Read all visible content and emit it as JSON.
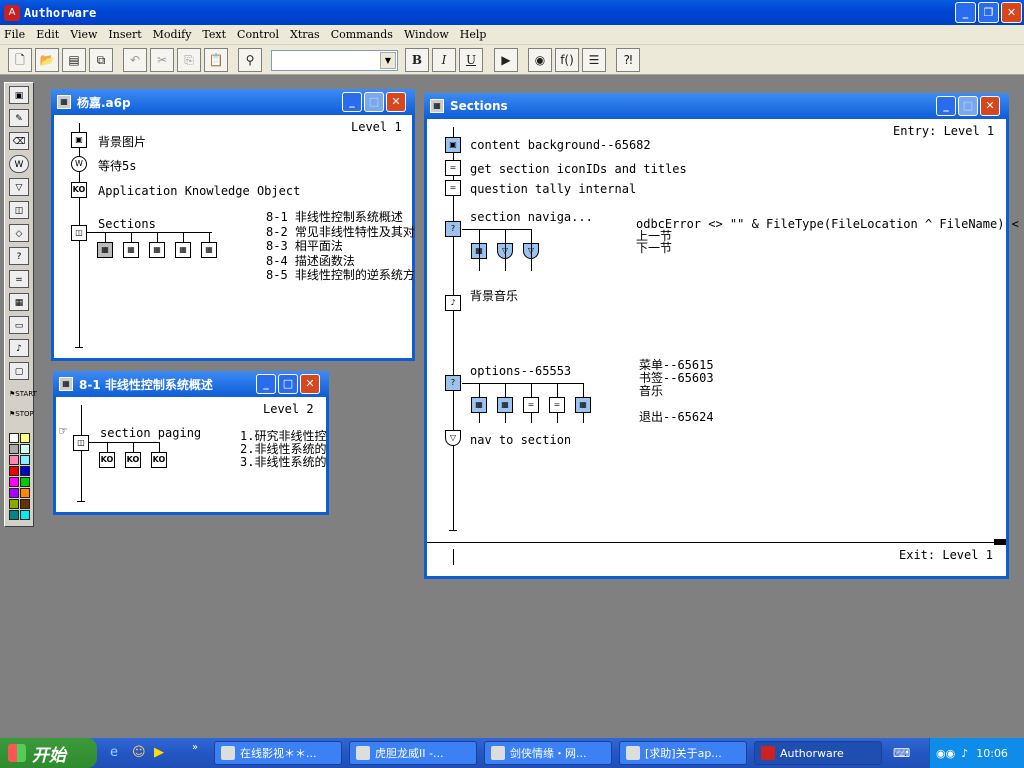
{
  "app": {
    "title": "Authorware"
  },
  "menu": [
    "File",
    "Edit",
    "View",
    "Insert",
    "Modify",
    "Text",
    "Control",
    "Xtras",
    "Commands",
    "Window",
    "Help"
  ],
  "toolbar": {
    "bold": "B",
    "italic": "I",
    "underline": "U",
    "combo_value": ""
  },
  "win_main": {
    "title": "杨嘉.a6p",
    "level": "Level 1",
    "items": [
      {
        "label": "背景图片",
        "icon": "display-icon"
      },
      {
        "label": "等待5s",
        "icon": "wait-icon"
      },
      {
        "label": "Application Knowledge Object",
        "icon": "ko-icon"
      },
      {
        "label": "Sections",
        "icon": "framework-icon"
      }
    ],
    "section_list": [
      "8-1 非线性控制系统概述",
      "8-2 常见非线性特性及其对",
      "8-3 相平面法",
      "8-4 描述函数法",
      "8-5 非线性控制的逆系统方"
    ]
  },
  "win_sub": {
    "title": "8-1 非线性控制系统概述",
    "level": "Level 2",
    "paging": "section paging",
    "items": [
      "1.研究非线性控",
      "2.非线性系统的",
      "3.非线性系统的"
    ]
  },
  "win_sections": {
    "title": "Sections",
    "entry": "Entry: Level 1",
    "exit": "Exit: Level 1",
    "rows": [
      "content background--65682",
      "get section iconIDs and titles",
      "question tally internal",
      "section naviga...",
      "背景音乐",
      "options--65553",
      "nav to section"
    ],
    "nav_condition": "odbcError <> \"\" & FileType(FileLocation ^ FileName) <",
    "nav_branches": [
      "上一节",
      "下一节"
    ],
    "option_branches": [
      "菜单--65615",
      "书签--65603",
      "音乐",
      "",
      "退出--65624"
    ]
  },
  "taskbar": {
    "start": "开始",
    "tasks": [
      "在线影视＊＊...",
      "虎胆龙威II -...",
      "剑侠情缘・网...",
      "[求助]关于ap...",
      "Authorware"
    ],
    "clock": "10:06"
  }
}
